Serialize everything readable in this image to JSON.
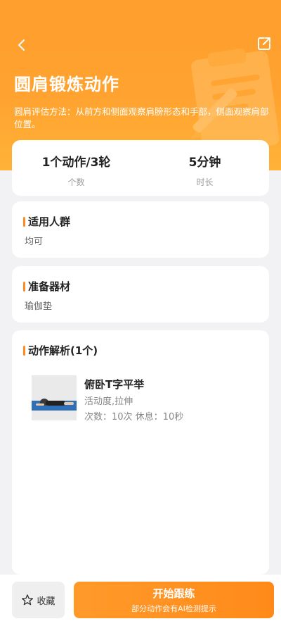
{
  "header": {
    "back_icon": "chevron-left-icon",
    "share_icon": "share-icon",
    "title": "圆肩锻炼动作",
    "description": "圆肩评估方法：从前方和侧面观察肩膀形态和手部，侧面观察肩部位置。",
    "illustration": "clipboard-pencil-illustration"
  },
  "stats": [
    {
      "value": "1个动作/3轮",
      "label": "个数"
    },
    {
      "value": "5分钟",
      "label": "时长"
    }
  ],
  "crowd": {
    "title": "适用人群",
    "text": "均可"
  },
  "equipment": {
    "title": "准备器材",
    "text": "瑜伽垫"
  },
  "actions": {
    "title": "动作解析(1个)",
    "items": [
      {
        "name": "俯卧T字平举",
        "tags": "活动度,拉伸",
        "meta": "次数：10次   休息：10秒",
        "thumb": "prone-t-raise-photo"
      }
    ]
  },
  "footer": {
    "favorite_label": "收藏",
    "favorite_icon": "star-outline-icon",
    "start_label": "开始跟练",
    "start_sub": "部分动作会有AI检测提示"
  },
  "colors": {
    "accent": "#ff9a2a",
    "bar": "#ff8a1f"
  }
}
